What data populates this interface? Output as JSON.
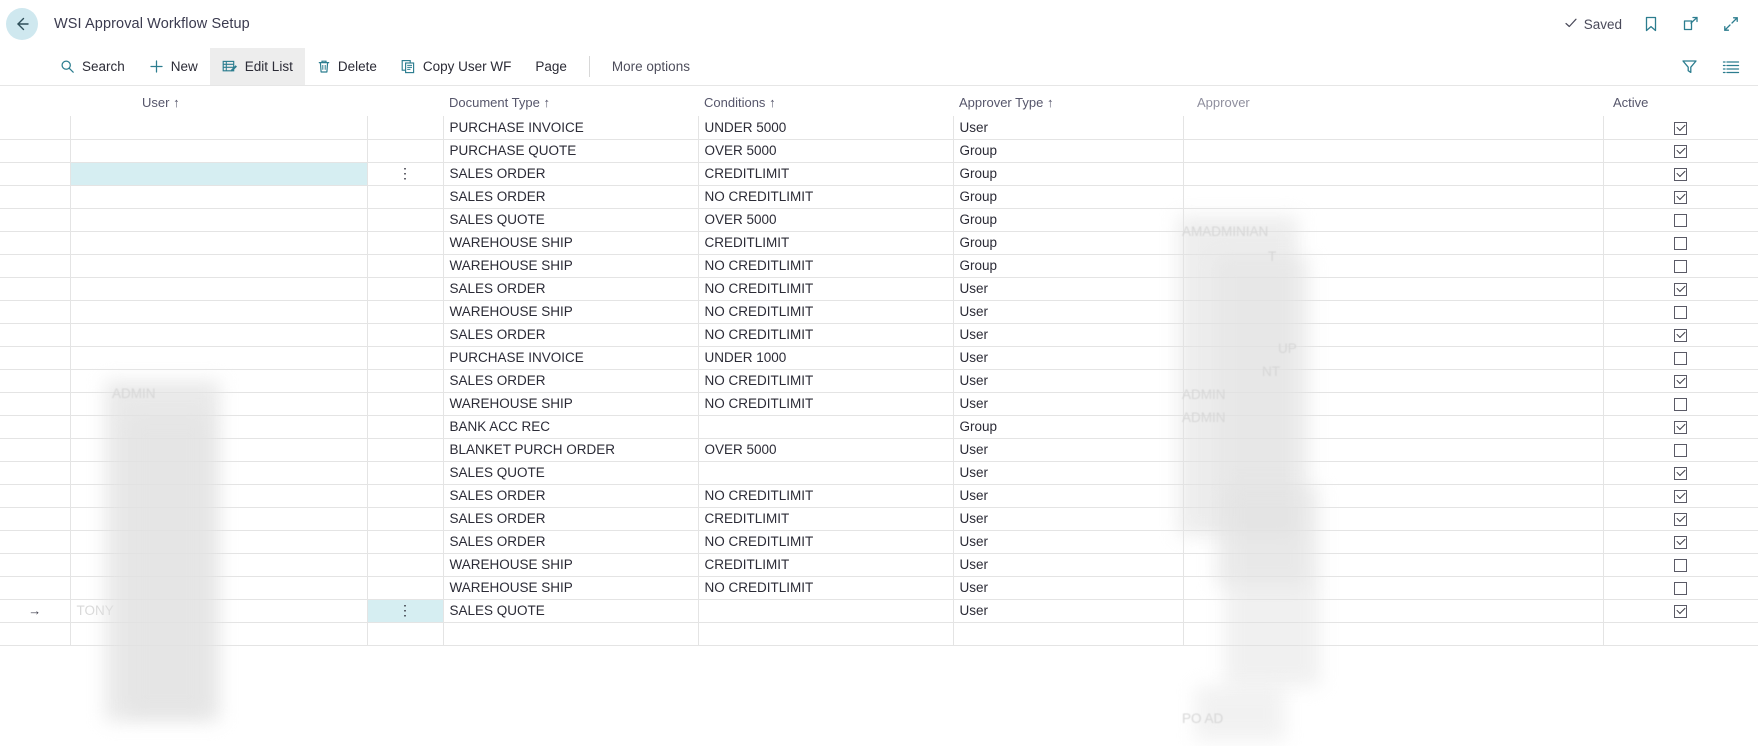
{
  "window": {
    "title": "WSI Approval Workflow Setup",
    "back_icon": "back-arrow-icon",
    "status": {
      "label": "Saved",
      "icon": "checkmark-icon"
    },
    "actions": [
      {
        "name": "bookmark",
        "icon": "bookmark-icon"
      },
      {
        "name": "open-in-new-window",
        "icon": "open-external-icon"
      },
      {
        "name": "collapse",
        "icon": "collapse-arrows-icon"
      }
    ]
  },
  "commandbar": {
    "items": [
      {
        "label": "Search",
        "icon": "search-icon",
        "active": false
      },
      {
        "label": "New",
        "icon": "plus-icon",
        "active": false
      },
      {
        "label": "Edit List",
        "icon": "edit-list-icon",
        "active": true
      },
      {
        "label": "Delete",
        "icon": "trash-icon",
        "active": false
      },
      {
        "label": "Copy User WF",
        "icon": "copy-icon",
        "active": false
      },
      {
        "label": "Page",
        "icon": "",
        "active": false
      }
    ],
    "more_options": "More options",
    "right_icons": [
      {
        "name": "filter",
        "icon": "filter-icon"
      },
      {
        "name": "list-options",
        "icon": "list-lines-icon"
      }
    ]
  },
  "grid": {
    "columns": [
      {
        "key": "indicator",
        "label": "",
        "sorted": false
      },
      {
        "key": "user",
        "label": "User",
        "sorted": true
      },
      {
        "key": "rowmenu",
        "label": "",
        "sorted": false
      },
      {
        "key": "document_type",
        "label": "Document Type",
        "sorted": true
      },
      {
        "key": "conditions",
        "label": "Conditions",
        "sorted": true
      },
      {
        "key": "approver_type",
        "label": "Approver Type",
        "sorted": true
      },
      {
        "key": "approver",
        "label": "Approver",
        "sorted": false
      },
      {
        "key": "active",
        "label": "Active",
        "sorted": false
      }
    ],
    "sort_glyph": "↑",
    "rowmenu_glyph": "⋮",
    "current_row_glyph": "→",
    "rows": [
      {
        "indicator": "",
        "user": "",
        "document_type": "PURCHASE INVOICE",
        "conditions": "UNDER 5000",
        "approver_type": "User",
        "approver": "",
        "active": true,
        "selected_cell": "",
        "rowmenu": false
      },
      {
        "indicator": "",
        "user": "",
        "document_type": "PURCHASE QUOTE",
        "conditions": "OVER 5000",
        "approver_type": "Group",
        "approver": "",
        "active": true,
        "selected_cell": "",
        "rowmenu": false
      },
      {
        "indicator": "",
        "user": "",
        "document_type": "SALES ORDER",
        "conditions": "CREDITLIMIT",
        "approver_type": "Group",
        "approver": "",
        "active": true,
        "selected_cell": "user",
        "rowmenu": true
      },
      {
        "indicator": "",
        "user": "",
        "document_type": "SALES ORDER",
        "conditions": "NO CREDITLIMIT",
        "approver_type": "Group",
        "approver": "",
        "active": true,
        "selected_cell": "",
        "rowmenu": false
      },
      {
        "indicator": "",
        "user": "",
        "document_type": "SALES QUOTE",
        "conditions": "OVER 5000",
        "approver_type": "Group",
        "approver": "",
        "active": false,
        "selected_cell": "",
        "rowmenu": false
      },
      {
        "indicator": "",
        "user": "",
        "document_type": "WAREHOUSE SHIP",
        "conditions": "CREDITLIMIT",
        "approver_type": "Group",
        "approver": "",
        "active": false,
        "selected_cell": "",
        "rowmenu": false
      },
      {
        "indicator": "",
        "user": "",
        "document_type": "WAREHOUSE SHIP",
        "conditions": "NO CREDITLIMIT",
        "approver_type": "Group",
        "approver": "",
        "active": false,
        "selected_cell": "",
        "rowmenu": false
      },
      {
        "indicator": "",
        "user": "",
        "document_type": "SALES ORDER",
        "conditions": "NO CREDITLIMIT",
        "approver_type": "User",
        "approver": "",
        "active": true,
        "selected_cell": "",
        "rowmenu": false
      },
      {
        "indicator": "",
        "user": "",
        "document_type": "WAREHOUSE SHIP",
        "conditions": "NO CREDITLIMIT",
        "approver_type": "User",
        "approver": "",
        "active": false,
        "selected_cell": "",
        "rowmenu": false
      },
      {
        "indicator": "",
        "user": "",
        "document_type": "SALES ORDER",
        "conditions": "NO CREDITLIMIT",
        "approver_type": "User",
        "approver": "",
        "active": true,
        "selected_cell": "",
        "rowmenu": false
      },
      {
        "indicator": "",
        "user": "",
        "document_type": "PURCHASE INVOICE",
        "conditions": "UNDER 1000",
        "approver_type": "User",
        "approver": "",
        "active": false,
        "selected_cell": "",
        "rowmenu": false
      },
      {
        "indicator": "",
        "user": "",
        "document_type": "SALES ORDER",
        "conditions": "NO CREDITLIMIT",
        "approver_type": "User",
        "approver": "",
        "active": true,
        "selected_cell": "",
        "rowmenu": false
      },
      {
        "indicator": "",
        "user": "",
        "document_type": "WAREHOUSE SHIP",
        "conditions": "NO CREDITLIMIT",
        "approver_type": "User",
        "approver": "",
        "active": false,
        "selected_cell": "",
        "rowmenu": false
      },
      {
        "indicator": "",
        "user": "",
        "document_type": "BANK ACC REC",
        "conditions": "",
        "approver_type": "Group",
        "approver": "",
        "active": true,
        "selected_cell": "",
        "rowmenu": false
      },
      {
        "indicator": "",
        "user": "",
        "document_type": "BLANKET PURCH ORDER",
        "conditions": "OVER 5000",
        "approver_type": "User",
        "approver": "",
        "active": false,
        "selected_cell": "",
        "rowmenu": false
      },
      {
        "indicator": "",
        "user": "",
        "document_type": "SALES QUOTE",
        "conditions": "",
        "approver_type": "User",
        "approver": "",
        "active": true,
        "selected_cell": "",
        "rowmenu": false
      },
      {
        "indicator": "",
        "user": "",
        "document_type": "SALES ORDER",
        "conditions": "NO CREDITLIMIT",
        "approver_type": "User",
        "approver": "",
        "active": true,
        "selected_cell": "",
        "rowmenu": false
      },
      {
        "indicator": "",
        "user": "",
        "document_type": "SALES ORDER",
        "conditions": "CREDITLIMIT",
        "approver_type": "User",
        "approver": "",
        "active": true,
        "selected_cell": "",
        "rowmenu": false
      },
      {
        "indicator": "",
        "user": "",
        "document_type": "SALES ORDER",
        "conditions": "NO CREDITLIMIT",
        "approver_type": "User",
        "approver": "",
        "active": true,
        "selected_cell": "",
        "rowmenu": false
      },
      {
        "indicator": "",
        "user": "",
        "document_type": "WAREHOUSE SHIP",
        "conditions": "CREDITLIMIT",
        "approver_type": "User",
        "approver": "",
        "active": false,
        "selected_cell": "",
        "rowmenu": false
      },
      {
        "indicator": "",
        "user": "",
        "document_type": "WAREHOUSE SHIP",
        "conditions": "NO CREDITLIMIT",
        "approver_type": "User",
        "approver": "",
        "active": false,
        "selected_cell": "",
        "rowmenu": false
      },
      {
        "indicator": "→",
        "user": "TONY",
        "document_type": "SALES QUOTE",
        "conditions": "",
        "approver_type": "User",
        "approver": "",
        "active": true,
        "selected_cell": "rowmenu",
        "rowmenu": true
      },
      {
        "indicator": "",
        "user": "",
        "document_type": "",
        "conditions": "",
        "approver_type": "",
        "approver": "",
        "active": null,
        "selected_cell": "",
        "rowmenu": false
      }
    ]
  },
  "colors": {
    "accent": "#2c7d8f",
    "selection": "#d6eef2",
    "grid_line": "#e4e4e4",
    "header_text": "#56566b",
    "back_button_bg": "#cfe8ef"
  }
}
